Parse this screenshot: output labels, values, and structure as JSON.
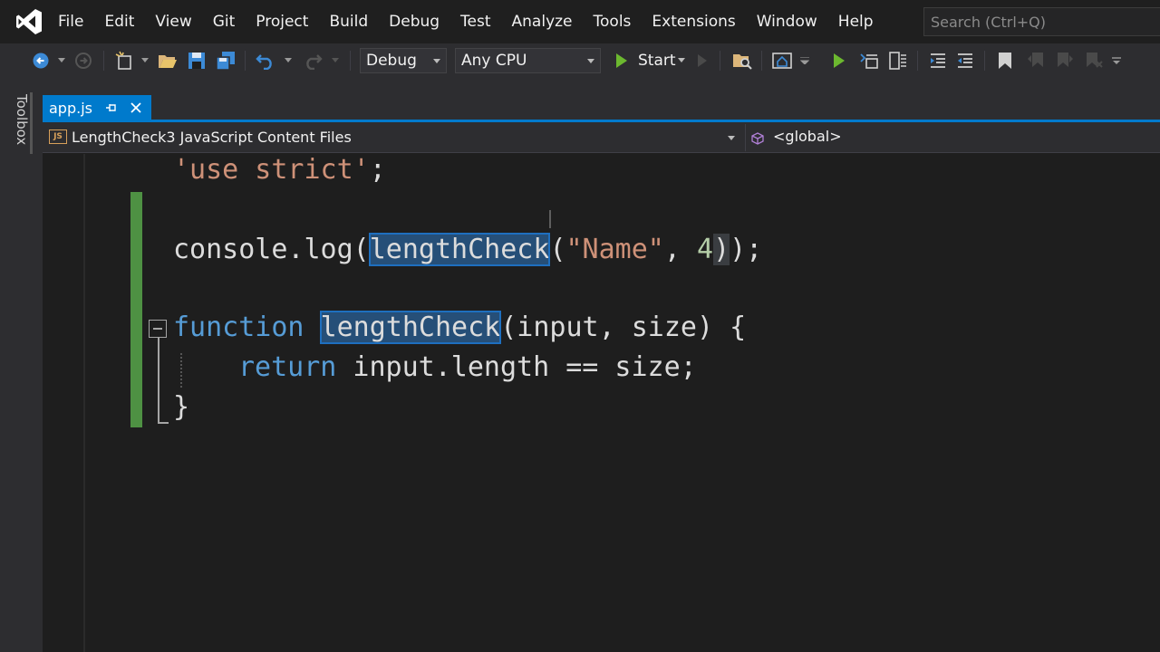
{
  "menu": {
    "items": [
      "File",
      "Edit",
      "View",
      "Git",
      "Project",
      "Build",
      "Debug",
      "Test",
      "Analyze",
      "Tools",
      "Extensions",
      "Window",
      "Help"
    ],
    "search_placeholder": "Search (Ctrl+Q)"
  },
  "toolbar": {
    "configuration": "Debug",
    "platform": "Any CPU",
    "start_label": "Start"
  },
  "toolbox": {
    "label": "Toolbox"
  },
  "tabs": [
    {
      "label": "app.js",
      "active": true,
      "pinned": false
    }
  ],
  "navbar": {
    "file_badge": "JS",
    "project": "LengthCheck3 JavaScript Content Files",
    "scope": "<global>"
  },
  "code": {
    "line1": {
      "str": "'use strict'",
      "punct": ";"
    },
    "line2": {
      "obj": "console.log(",
      "fn": "lengthCheck",
      "open": "(",
      "arg_str": "\"Name\"",
      "sep": ", ",
      "arg_num": "4",
      "close": ")",
      "tail": ");"
    },
    "line3": {
      "kw": "function",
      "space": " ",
      "fn": "lengthCheck",
      "params": "(input, size) {"
    },
    "line4": {
      "kw": "return",
      "body": " input.length == size;"
    },
    "line5": {
      "brace": "}"
    }
  },
  "colors": {
    "accent": "#007acc",
    "keyword": "#569cd6",
    "string": "#ce9178",
    "number": "#b5cea8",
    "selection": "#264f78",
    "change_bar": "#57a64a"
  }
}
